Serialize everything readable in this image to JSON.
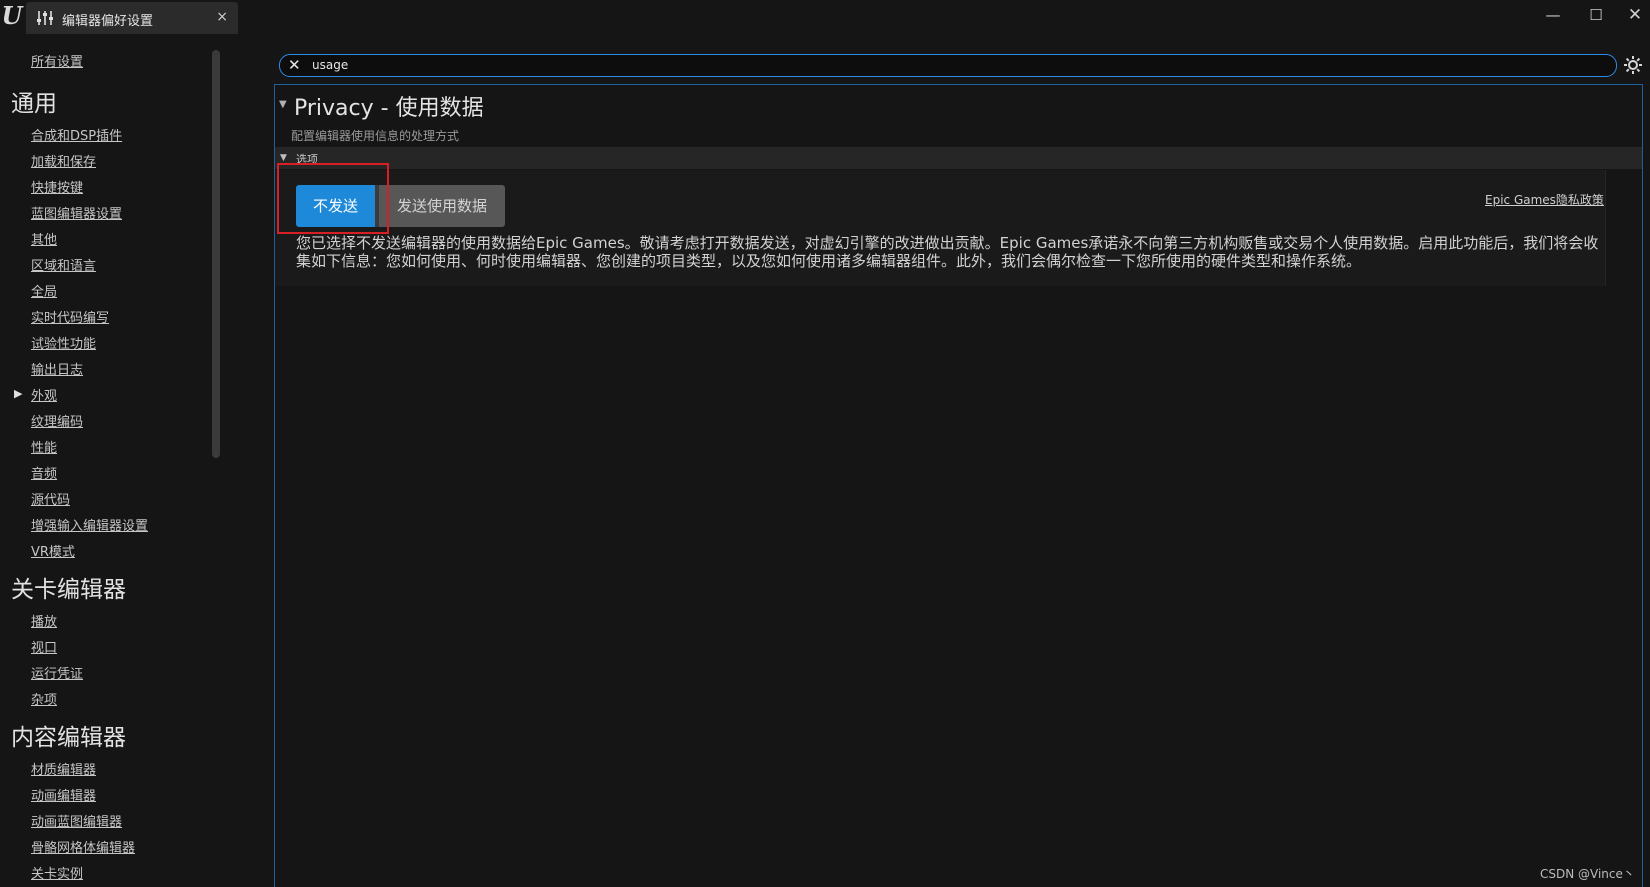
{
  "titlebar": {
    "tab_label": "编辑器偏好设置",
    "tab_close": "×",
    "minimize": "—",
    "maximize": "☐",
    "close": "✕",
    "logo": "U"
  },
  "sidebar": {
    "all_settings": "所有设置",
    "groups": [
      {
        "title": "通用",
        "items": [
          "合成和DSP插件",
          "加载和保存",
          "快捷按键",
          "蓝图编辑器设置",
          "其他",
          "区域和语言",
          "全局",
          "实时代码编写",
          "试验性功能",
          "输出日志",
          "外观",
          "纹理编码",
          "性能",
          "音频",
          "源代码",
          "增强输入编辑器设置",
          "VR模式"
        ]
      },
      {
        "title": "关卡编辑器",
        "items": [
          "播放",
          "视口",
          "运行凭证",
          "杂项"
        ]
      },
      {
        "title": "内容编辑器",
        "items": [
          "材质编辑器",
          "动画编辑器",
          "动画蓝图编辑器",
          "骨骼网格体编辑器",
          "关卡实例"
        ]
      }
    ],
    "expand_arrow": "▶"
  },
  "search": {
    "clear_icon": "✕",
    "value": "usage"
  },
  "main": {
    "section_title": "Privacy - 使用数据",
    "section_desc": "配置编辑器使用信息的处理方式",
    "category": "选项",
    "btn_nosend": "不发送",
    "btn_send": "发送使用数据",
    "policy_link": "Epic Games隐私政策",
    "notice": "您已选择不发送编辑器的使用数据给Epic Games。敬请考虑打开数据发送，对虚幻引擎的改进做出贡献。Epic Games承诺永不向第三方机构贩售或交易个人使用数据。启用此功能后，我们将会收集如下信息：您如何使用、何时使用编辑器、您创建的项目类型，以及您如何使用诸多编辑器组件。此外，我们会偶尔检查一下您所使用的硬件类型和操作系统。"
  },
  "watermark": "CSDN @Vince丶",
  "colors": {
    "accent": "#1d89d8",
    "highlight": "#d81f26",
    "background": "#151515"
  }
}
